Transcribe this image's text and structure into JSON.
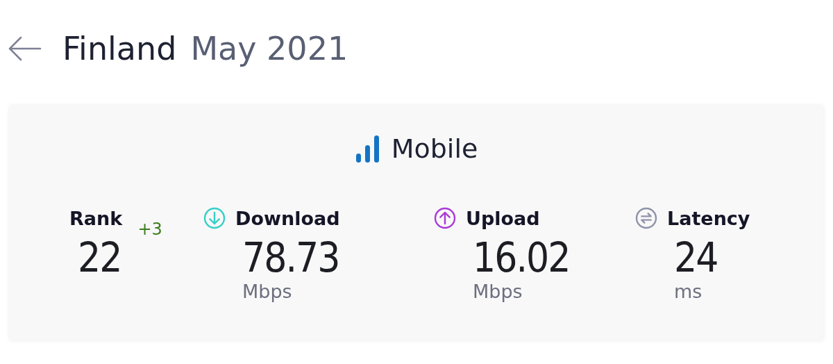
{
  "header": {
    "country": "Finland",
    "period": "May 2021"
  },
  "card": {
    "title": "Mobile",
    "metrics": [
      {
        "kind": "rank",
        "label": "Rank",
        "value": "22",
        "change": "+3"
      },
      {
        "kind": "download",
        "label": "Download",
        "value": "78.73",
        "unit": "Mbps"
      },
      {
        "kind": "upload",
        "label": "Upload",
        "value": "16.02",
        "unit": "Mbps"
      },
      {
        "kind": "latency",
        "label": "Latency",
        "value": "24",
        "unit": "ms"
      }
    ]
  }
}
